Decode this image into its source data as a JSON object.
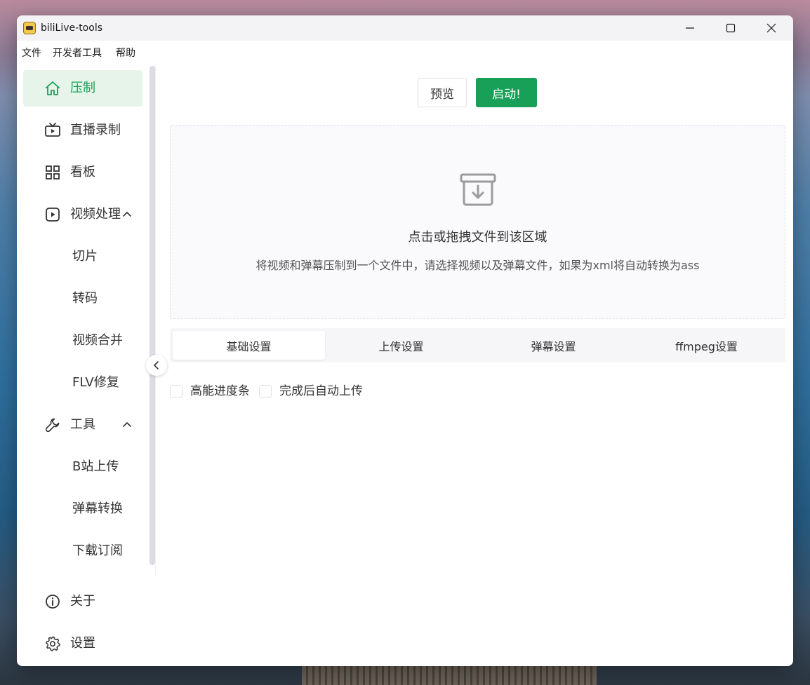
{
  "window": {
    "title": "biliLive-tools"
  },
  "menubar": {
    "items": [
      "文件",
      "开发者工具",
      "帮助"
    ]
  },
  "sidebar": {
    "items": [
      {
        "label": "压制",
        "icon": "home-icon",
        "active": true
      },
      {
        "label": "直播录制",
        "icon": "tv-icon"
      },
      {
        "label": "看板",
        "icon": "dashboard-icon"
      },
      {
        "label": "视频处理",
        "icon": "play-circle-icon",
        "expanded": true
      },
      {
        "label": "切片"
      },
      {
        "label": "转码"
      },
      {
        "label": "视频合并"
      },
      {
        "label": "FLV修复"
      },
      {
        "label": "工具",
        "icon": "wrench-icon",
        "expanded": true
      },
      {
        "label": "B站上传"
      },
      {
        "label": "弹幕转换"
      },
      {
        "label": "下载订阅"
      }
    ],
    "footer": [
      {
        "label": "关于",
        "icon": "info-icon"
      },
      {
        "label": "设置",
        "icon": "gear-icon"
      }
    ]
  },
  "toolbar": {
    "preview_label": "预览",
    "start_label": "启动!"
  },
  "dropzone": {
    "title": "点击或拖拽文件到该区域",
    "description": "将视频和弹幕压制到一个文件中，请选择视频以及弹幕文件，如果为xml将自动转换为ass"
  },
  "tabs": [
    {
      "label": "基础设置",
      "active": true
    },
    {
      "label": "上传设置"
    },
    {
      "label": "弹幕设置"
    },
    {
      "label": "ffmpeg设置"
    }
  ],
  "options": {
    "hq_progress": "高能进度条",
    "auto_upload": "完成后自动上传"
  },
  "colors": {
    "accent": "#18a058",
    "active_bg": "#e6f4ea"
  }
}
